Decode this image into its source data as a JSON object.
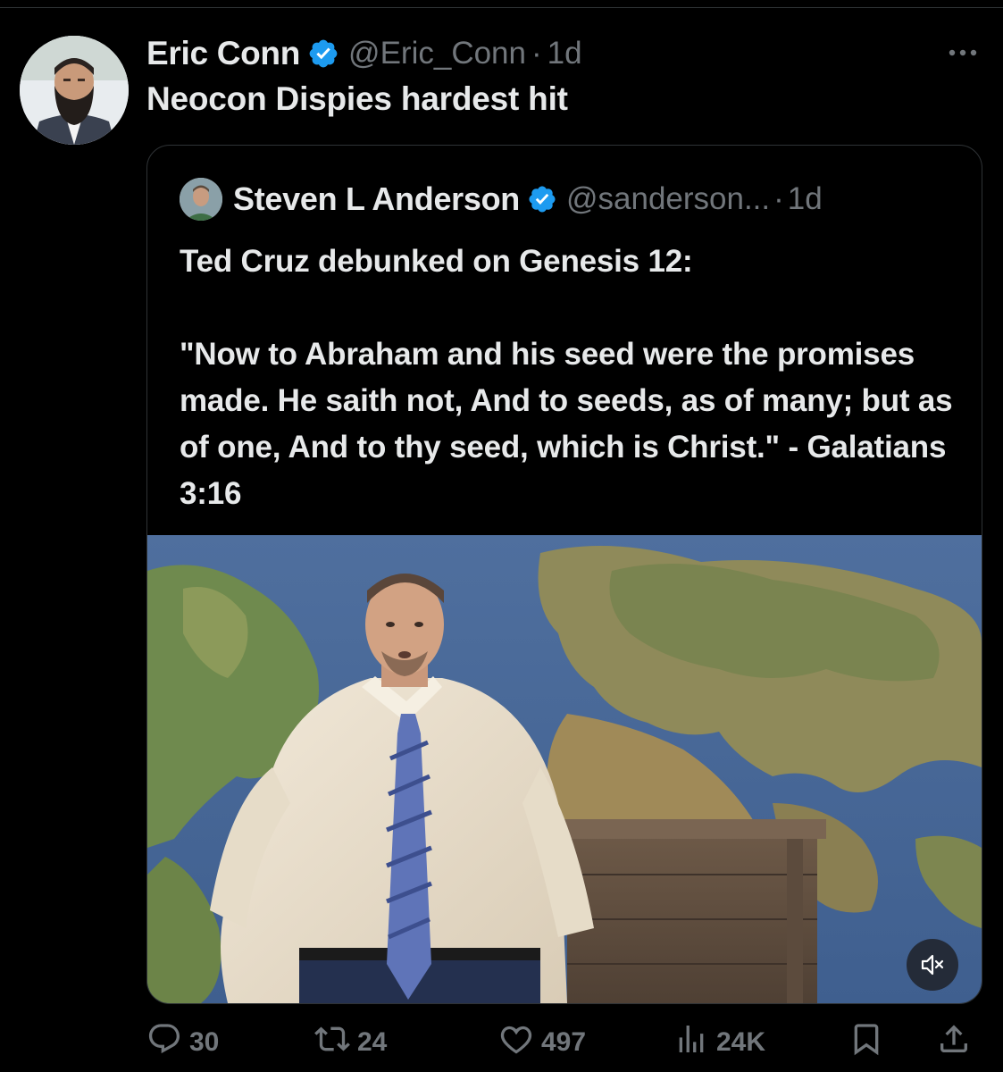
{
  "tweet": {
    "author_name": "Eric Conn",
    "author_handle": "@Eric_Conn",
    "separator": "·",
    "time": "1d",
    "text": "Neocon Dispies hardest hit"
  },
  "quoted_tweet": {
    "author_name": "Steven L Anderson",
    "author_handle": "@sanderson...",
    "separator": "·",
    "time": "1d",
    "text": "Ted Cruz debunked on Genesis 12:\n\n\"Now to Abraham and his seed were the promises made. He saith not, And to seeds, as of many; but as of one, And to thy seed, which is Christ.\" - Galatians 3:16"
  },
  "actions": {
    "replies": "30",
    "reposts": "24",
    "likes": "497",
    "views": "24K"
  },
  "icons": {
    "verified": "verified-badge-icon",
    "more": "more-icon",
    "mute": "muted-speaker-icon",
    "reply": "reply-icon",
    "repost": "repost-icon",
    "like": "heart-icon",
    "views": "views-icon",
    "bookmark": "bookmark-icon",
    "share": "share-icon"
  },
  "colors": {
    "background": "#000000",
    "text": "#e7e9ea",
    "secondary_text": "#71767b",
    "verified_blue": "#1d9bf0",
    "border": "#2f3336"
  }
}
